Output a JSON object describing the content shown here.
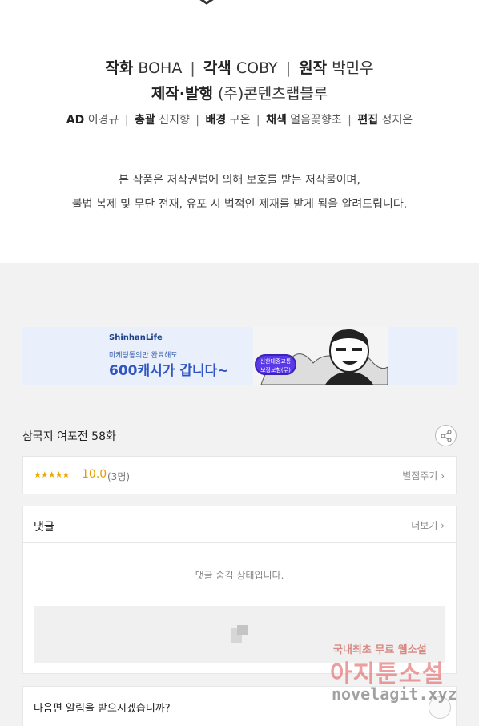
{
  "credits": {
    "art_label": "작화",
    "art_name": "BOHA",
    "adapt_label": "각색",
    "adapt_name": "COBY",
    "original_label": "원작",
    "original_name": "박민우",
    "production_label": "제작·발행",
    "production_name": "(주)콘텐츠랩블루",
    "separator": "|",
    "staff": [
      {
        "label": "AD",
        "name": "이경규"
      },
      {
        "label": "총괄",
        "name": "신지향"
      },
      {
        "label": "배경",
        "name": "구온"
      },
      {
        "label": "채색",
        "name": "얼음꽃향초"
      },
      {
        "label": "편집",
        "name": "정지은"
      }
    ]
  },
  "notice": {
    "line1": "본 작품은 저작권법에 의해 보호를 받는 저작물이며,",
    "line2": "불법 복제 및 무단 전재, 유포 시 법적인 제재를 받게 됨을 알려드립니다."
  },
  "banner": {
    "brand": "ShinhanLife",
    "subtitle": "마케팅동의만 완료해도",
    "headline": "600캐시가 갑니다~",
    "badge_line1": "신한대중교통",
    "badge_line2": "보장보험(무)"
  },
  "episode": {
    "title": "삼국지 여포전 58화",
    "share_icon": "share-icon"
  },
  "rating": {
    "stars": "★★★★★",
    "score": "10.0",
    "count": "(3명)",
    "rate_link": "별점주기",
    "chevron": "›"
  },
  "comments": {
    "title": "댓글",
    "more_link": "더보기",
    "chevron": "›",
    "hidden_message": "댓글 숨김 상태입니다."
  },
  "notify": {
    "text": "다음편 알림을 받으시겠습니까?"
  },
  "watermark": {
    "line1": "국내최초 무료 웹소설",
    "line2": "아지툰소설",
    "line3": "novelagit.xyz"
  },
  "colors": {
    "page_bg": "#f2f2f2",
    "banner_bg": "#e9f0fb",
    "star": "#f0a500",
    "banner_headline": "#2f55c2"
  }
}
